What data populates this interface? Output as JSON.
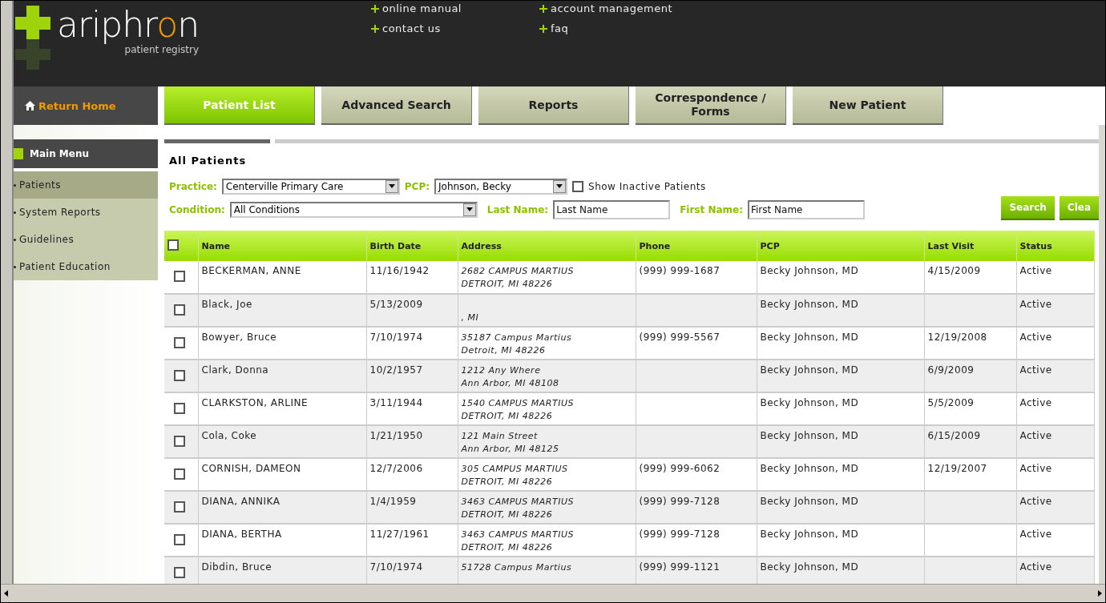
{
  "header": {
    "logo": {
      "name_start": "ariphr",
      "name_accent": "o",
      "name_end": "n",
      "tagline": "patient registry"
    },
    "links": [
      {
        "label": "online manual"
      },
      {
        "label": "account management"
      },
      {
        "label": "contact us"
      },
      {
        "label": "faq"
      }
    ]
  },
  "nav": {
    "home": "Return Home",
    "tabs": [
      {
        "label": "Patient List",
        "selected": true
      },
      {
        "label": "Advanced Search",
        "selected": false
      },
      {
        "label": "Reports",
        "selected": false
      },
      {
        "label": "Correspondence / Forms",
        "selected": false
      },
      {
        "label": "New Patient",
        "selected": false
      }
    ]
  },
  "sidebar": {
    "title": "Main Menu",
    "items": [
      {
        "label": "Patients",
        "selected": true
      },
      {
        "label": "System Reports",
        "selected": false
      },
      {
        "label": "Guidelines",
        "selected": false
      },
      {
        "label": "Patient Education",
        "selected": false
      }
    ]
  },
  "page_title": "All Patients",
  "filters": {
    "practice": {
      "label": "Practice:",
      "value": "Centerville Primary Care"
    },
    "pcp": {
      "label": "PCP:",
      "value": "Johnson, Becky"
    },
    "show_inactive": {
      "label": "Show Inactive Patients",
      "checked": false
    },
    "condition": {
      "label": "Condition:",
      "value": "All Conditions"
    },
    "last_name": {
      "label": "Last Name:",
      "placeholder": "Last Name"
    },
    "first_name": {
      "label": "First Name:",
      "placeholder": "First Name"
    },
    "buttons": [
      "Search",
      "Clea"
    ]
  },
  "table": {
    "select_all": {
      "checked": false
    },
    "columns": [
      "Name",
      "Birth Date",
      "Address",
      "Phone",
      "PCP",
      "Last Visit",
      "Status"
    ],
    "rows": [
      {
        "checked": false,
        "name": "BECKERMAN, ANNE",
        "birth_date": "11/16/1942",
        "address": {
          "street": "2682 CAMPUS MARTIUS",
          "city": "DETROIT, MI 48226"
        },
        "phone": "(999) 999-1687",
        "pcp": "Becky Johnson, MD",
        "last_visit": "4/15/2009",
        "status": "Active"
      },
      {
        "checked": false,
        "name": "Black, Joe",
        "birth_date": "5/13/2009",
        "address": {
          "city": ", MI"
        },
        "pcp": "Becky Johnson, MD",
        "status": "Active"
      },
      {
        "checked": false,
        "name": "Bowyer, Bruce",
        "birth_date": "7/10/1974",
        "address": {
          "street": "35187 Campus Martius",
          "city": "Detroit, MI 48226"
        },
        "phone": "(999) 999-5567",
        "pcp": "Becky Johnson, MD",
        "last_visit": "12/19/2008",
        "status": "Active"
      },
      {
        "checked": false,
        "name": "Clark, Donna",
        "birth_date": "10/2/1957",
        "address": {
          "street": "1212 Any Where",
          "city": "Ann Arbor, MI 48108"
        },
        "pcp": "Becky Johnson, MD",
        "last_visit": "6/9/2009",
        "status": "Active"
      },
      {
        "checked": false,
        "name": "CLARKSTON, ARLINE",
        "birth_date": "3/11/1944",
        "address": {
          "street": "1540 CAMPUS MARTIUS",
          "city": "DETROIT, MI 48226"
        },
        "pcp": "Becky Johnson, MD",
        "last_visit": "5/5/2009",
        "status": "Active"
      },
      {
        "checked": false,
        "name": "Cola, Coke",
        "birth_date": "1/21/1950",
        "address": {
          "street": "121 Main Street",
          "city": "Ann Arbor, MI 48125"
        },
        "pcp": "Becky Johnson, MD",
        "last_visit": "6/15/2009",
        "status": "Active"
      },
      {
        "checked": false,
        "name": "CORNISH, DAMEON",
        "birth_date": "12/7/2006",
        "address": {
          "street": "305 CAMPUS MARTIUS",
          "city": "DETROIT, MI 48226"
        },
        "phone": "(999) 999-6062",
        "pcp": "Becky Johnson, MD",
        "last_visit": "12/19/2007",
        "status": "Active"
      },
      {
        "checked": false,
        "name": "DIANA, ANNIKA",
        "birth_date": "1/4/1959",
        "address": {
          "street": "3463 CAMPUS MARTIUS",
          "city": "DETROIT, MI 48226"
        },
        "phone": "(999) 999-7128",
        "pcp": "Becky Johnson, MD",
        "status": "Active"
      },
      {
        "checked": false,
        "name": "DIANA, BERTHA",
        "birth_date": "11/27/1961",
        "address": {
          "street": "3463 CAMPUS MARTIUS",
          "city": "DETROIT, MI 48226"
        },
        "phone": "(999) 999-7128",
        "pcp": "Becky Johnson, MD",
        "status": "Active"
      },
      {
        "checked": false,
        "name": "Dibdin, Bruce",
        "birth_date": "7/10/1974",
        "address": {
          "street": "51728 Campus Martius"
        },
        "phone": "(999) 999-1121",
        "pcp": "Becky Johnson, MD",
        "status": "Active"
      }
    ]
  }
}
